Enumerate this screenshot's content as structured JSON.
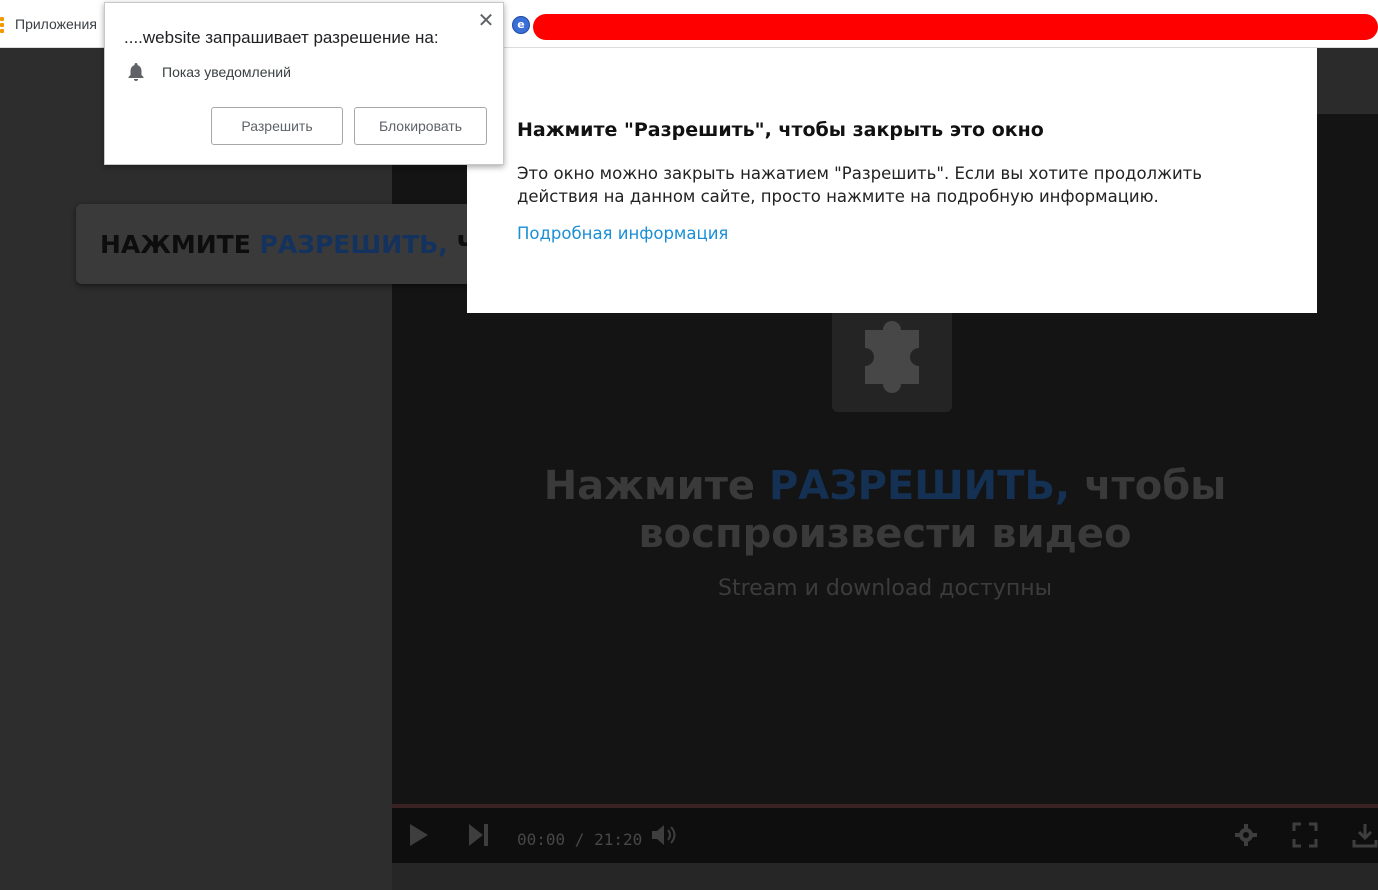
{
  "bookmarks_bar": {
    "apps_label": "Приложения"
  },
  "banner": {
    "prefix": "НАЖМИТЕ ",
    "accent": "РАЗРЕШИТЬ,",
    "suffix": " Ч"
  },
  "video": {
    "headline_prefix": "Нажмите ",
    "headline_accent": "РАЗРЕШИТЬ,",
    "headline_suffix": " чтобы",
    "headline_line2": "воспроизвести видео",
    "subline": "Stream и download доступны",
    "time_display": "00:00 / 21:20",
    "progress": 0
  },
  "permission_popup": {
    "title": "....website запрашивает разрешение на:",
    "item_label": "Показ уведомлений",
    "allow_label": "Разрешить",
    "block_label": "Блокировать"
  },
  "modal": {
    "title": "Нажмите \"Разрешить\", чтобы закрыть это окно",
    "body": "Это окно можно закрыть нажатием \"Разрешить\". Если вы хотите продолжить действия на данном сайте, просто нажмите на подробную информацию.",
    "link": "Подробная информация"
  },
  "colors": {
    "redaction": "#ff0000",
    "link": "#1a8fd6",
    "accent_text": "#143154"
  },
  "icons": [
    "apps-grid-icon",
    "site-favicon-icon",
    "close-icon",
    "bell-icon",
    "puzzle-icon",
    "play-icon",
    "next-icon",
    "volume-icon",
    "settings-icon",
    "fullscreen-icon",
    "download-icon"
  ]
}
